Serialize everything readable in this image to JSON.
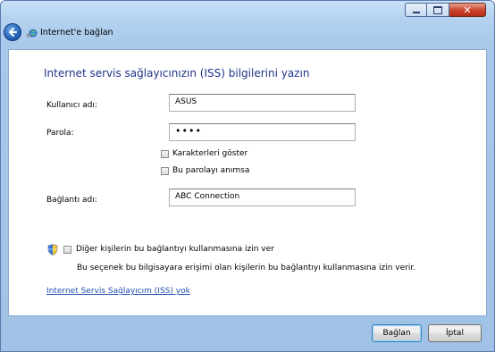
{
  "window": {
    "title": "Internet'e bağlan",
    "caption": {
      "minimize_icon": "minimize-icon",
      "maximize_icon": "maximize-icon",
      "close_icon": "close-icon"
    }
  },
  "page": {
    "heading": "Internet servis sağlayıcınızın (ISS) bilgilerini yazın"
  },
  "form": {
    "username": {
      "label": "Kullanıcı adı:",
      "value": "ASUS"
    },
    "password": {
      "label": "Parola:",
      "value": "••••"
    },
    "show_characters": {
      "label": "Karakterleri göster",
      "checked": false
    },
    "remember_password": {
      "label": "Bu parolayı anımsa",
      "checked": false
    },
    "connection_name": {
      "label": "Bağlantı adı:",
      "value": "ABC Connection"
    }
  },
  "sharing": {
    "checkbox_label": "Diğer kişilerin bu bağlantıyı kullanmasına izin ver",
    "checked": false,
    "description": "Bu seçenek bu bilgisayara erişimi olan kişilerin bu bağlantıyı kullanmasına izin verir."
  },
  "link": {
    "no_isp": "Internet Servis Sağlayıcım (ISS) yok"
  },
  "buttons": {
    "connect": "Bağlan",
    "cancel": "İptal"
  },
  "colors": {
    "heading": "#1e3287",
    "link": "#1f4fb3",
    "close_button": "#c8402a"
  }
}
